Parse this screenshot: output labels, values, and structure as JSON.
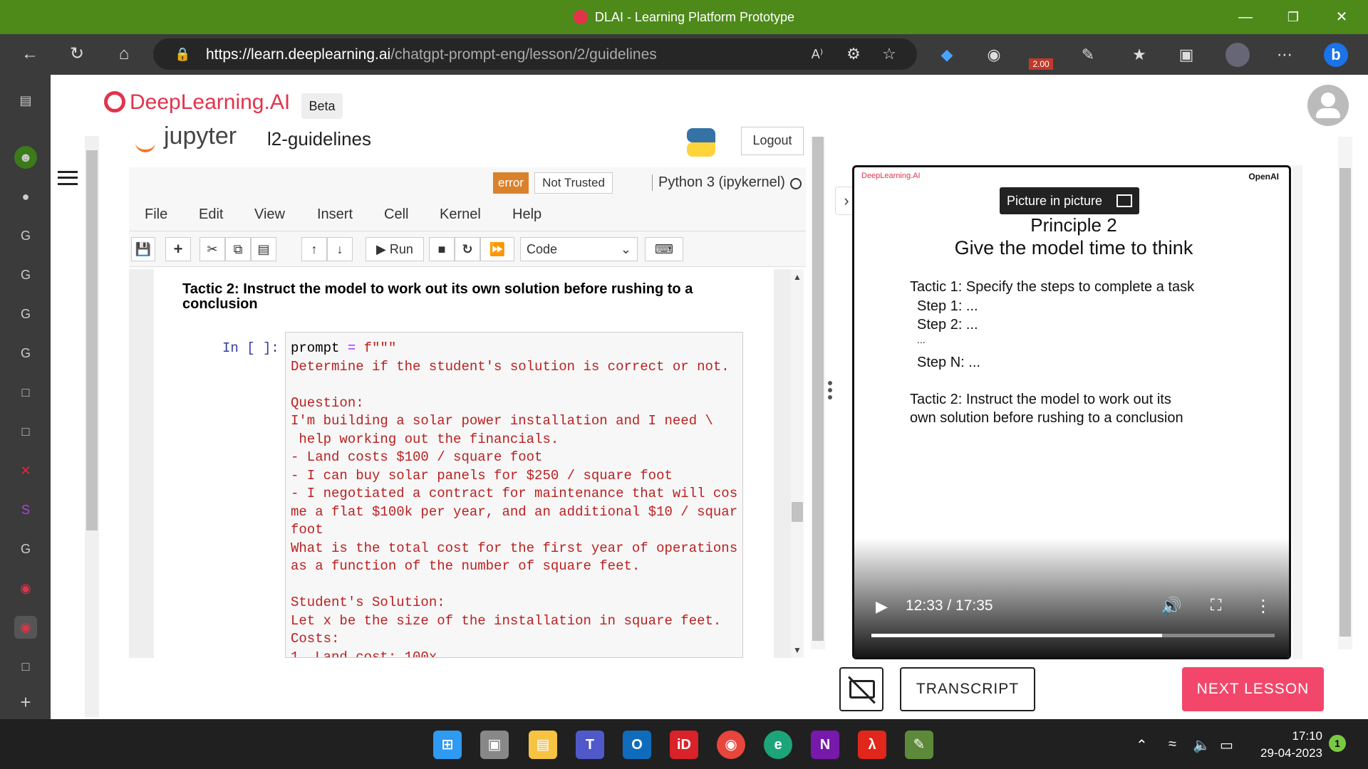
{
  "window": {
    "title": "DLAI - Learning Platform Prototype"
  },
  "browser": {
    "url_host": "https://learn.deeplearning.ai",
    "url_path": "/chatgpt-prompt-eng/lesson/2/guidelines",
    "zoom_badge": "2.00"
  },
  "header": {
    "brand": "DeepLearning.AI",
    "badge": "Beta"
  },
  "notebook": {
    "app": "jupyter",
    "name": "l2-guidelines",
    "logout": "Logout",
    "error_badge": "error",
    "trust": "Not Trusted",
    "kernel": "Python 3 (ipykernel)",
    "menu": [
      "File",
      "Edit",
      "View",
      "Insert",
      "Cell",
      "Kernel",
      "Help"
    ],
    "run_label": "Run",
    "cell_type": "Code",
    "tactic_heading": "Tactic 2: Instruct the model to work out its own solution before rushing to a conclusion",
    "input_prompt": "In [ ]:",
    "code_lines": [
      "prompt = f\"\"\"",
      "Determine if the student's solution is correct or not.",
      "",
      "Question:",
      "I'm building a solar power installation and I need \\",
      " help working out the financials.",
      "- Land costs $100 / square foot",
      "- I can buy solar panels for $250 / square foot",
      "- I negotiated a contract for maintenance that will cos",
      "me a flat $100k per year, and an additional $10 / squar",
      "foot",
      "What is the total cost for the first year of operations",
      "as a function of the number of square feet.",
      "",
      "Student's Solution:",
      "Let x be the size of the installation in square feet.",
      "Costs:",
      "1. Land cost: 100x"
    ]
  },
  "video": {
    "brand_left": "DeepLearning.AI",
    "brand_right": "OpenAI",
    "pip_label": "Picture in picture",
    "principle": "Principle 2",
    "title": "Give the model time to think",
    "lines": [
      "Tactic 1: Specify the steps to complete a task",
      "Step 1: ...",
      "Step 2: ...",
      "...",
      "Step N: ...",
      "Tactic 2: Instruct the model to work out its",
      "own solution before rushing to a conclusion"
    ],
    "time": "12:33 / 17:35",
    "progress": 0.72
  },
  "actions": {
    "transcript": "TRANSCRIPT",
    "next": "NEXT LESSON"
  },
  "taskbar": {
    "time": "17:10",
    "date": "29-04-2023",
    "notifications": "1"
  }
}
